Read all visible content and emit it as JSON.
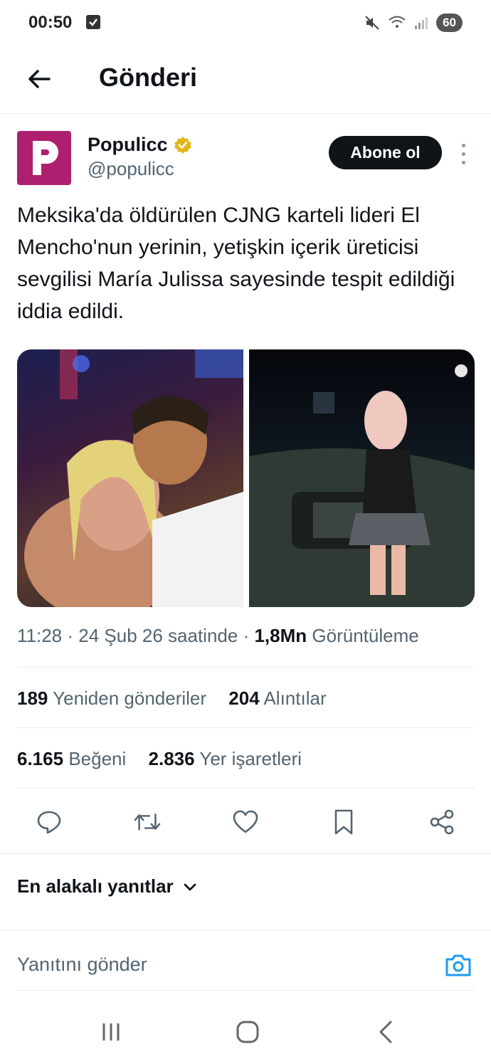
{
  "status_bar": {
    "time": "00:50",
    "battery": "60"
  },
  "header": {
    "title": "Gönderi"
  },
  "author": {
    "name": "Populicc",
    "handle": "@populicc",
    "avatar_letter": "P",
    "avatar_color": "#ad1f6f",
    "verified_color": "#e2b719"
  },
  "follow_label": "Abone ol",
  "tweet": {
    "text": "Meksika'da öldürülen CJNG karteli lideri El Mencho'nun yerinin, yetişkin içerik üreticisi sevgilisi María Julissa sayesinde tespit edildiği iddia edildi."
  },
  "meta": {
    "time": "11:28",
    "date": "24 Şub 26 saatinde",
    "views": "1,8Mn",
    "views_label": "Görüntüleme"
  },
  "stats": {
    "reposts_count": "189",
    "reposts_label": "Yeniden gönderiler",
    "quotes_count": "204",
    "quotes_label": "Alıntılar",
    "likes_count": "6.165",
    "likes_label": "Beğeni",
    "bookmarks_count": "2.836",
    "bookmarks_label": "Yer işaretleri"
  },
  "actions": [
    "reply-icon",
    "repost-icon",
    "like-icon",
    "bookmark-icon",
    "share-icon"
  ],
  "replies": {
    "sort_label": "En alakalı yanıtlar",
    "placeholder": "Yanıtını gönder"
  },
  "colors": {
    "text": "#0f1419",
    "secondary": "#536471",
    "accent": "#1d9bf0"
  }
}
